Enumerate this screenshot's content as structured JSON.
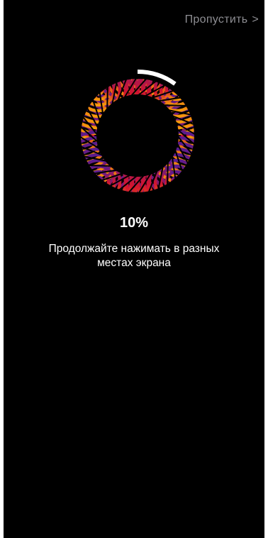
{
  "header": {
    "skip_label": "Пропустить",
    "skip_chevron": ">"
  },
  "progress": {
    "percent_label": "10%",
    "value": 0.1
  },
  "instruction": {
    "line1": "Продолжайте нажимать в разных",
    "line2": "местах экрана"
  },
  "colors": {
    "background": "#000000",
    "skip_text": "#8e8e93",
    "progress_arc": "#ffffff",
    "ring_top": "#5b1c8f",
    "ring_middle": "#d3142f",
    "ring_bottom": "#f59a0a"
  },
  "icons": {
    "ring": "fingerprint-ring-icon",
    "chevron": "chevron-right-icon"
  }
}
